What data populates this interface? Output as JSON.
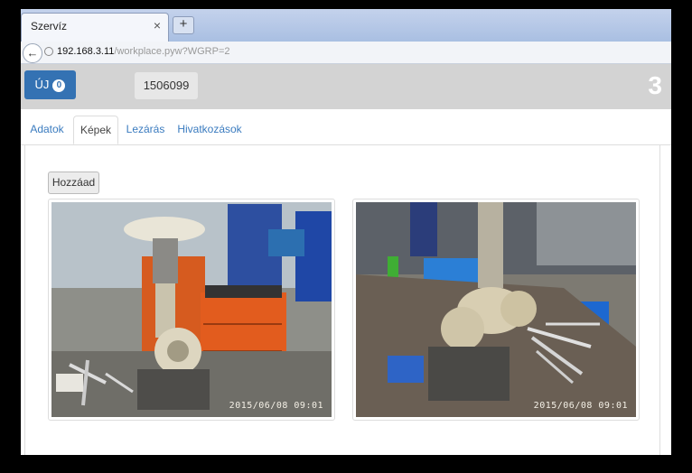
{
  "browser": {
    "tab_title": "Szervíz",
    "tab_close": "×",
    "new_tab": "+",
    "back": "←",
    "url_host": "192.168.3.11",
    "url_path": "/workplace.pyw?WGRP=2"
  },
  "header": {
    "new_label": "ÚJ",
    "new_badge": "0",
    "order_number": "1506099",
    "count": "3"
  },
  "tabs": [
    {
      "label": "Adatok",
      "active": false
    },
    {
      "label": "Képek",
      "active": true
    },
    {
      "label": "Lezárás",
      "active": false
    },
    {
      "label": "Hivatkozások",
      "active": false
    }
  ],
  "images": {
    "add_label": "Hozzáad",
    "items": [
      {
        "timestamp": "2015/06/08 09:01"
      },
      {
        "timestamp": "2015/06/08 09:01"
      }
    ]
  }
}
